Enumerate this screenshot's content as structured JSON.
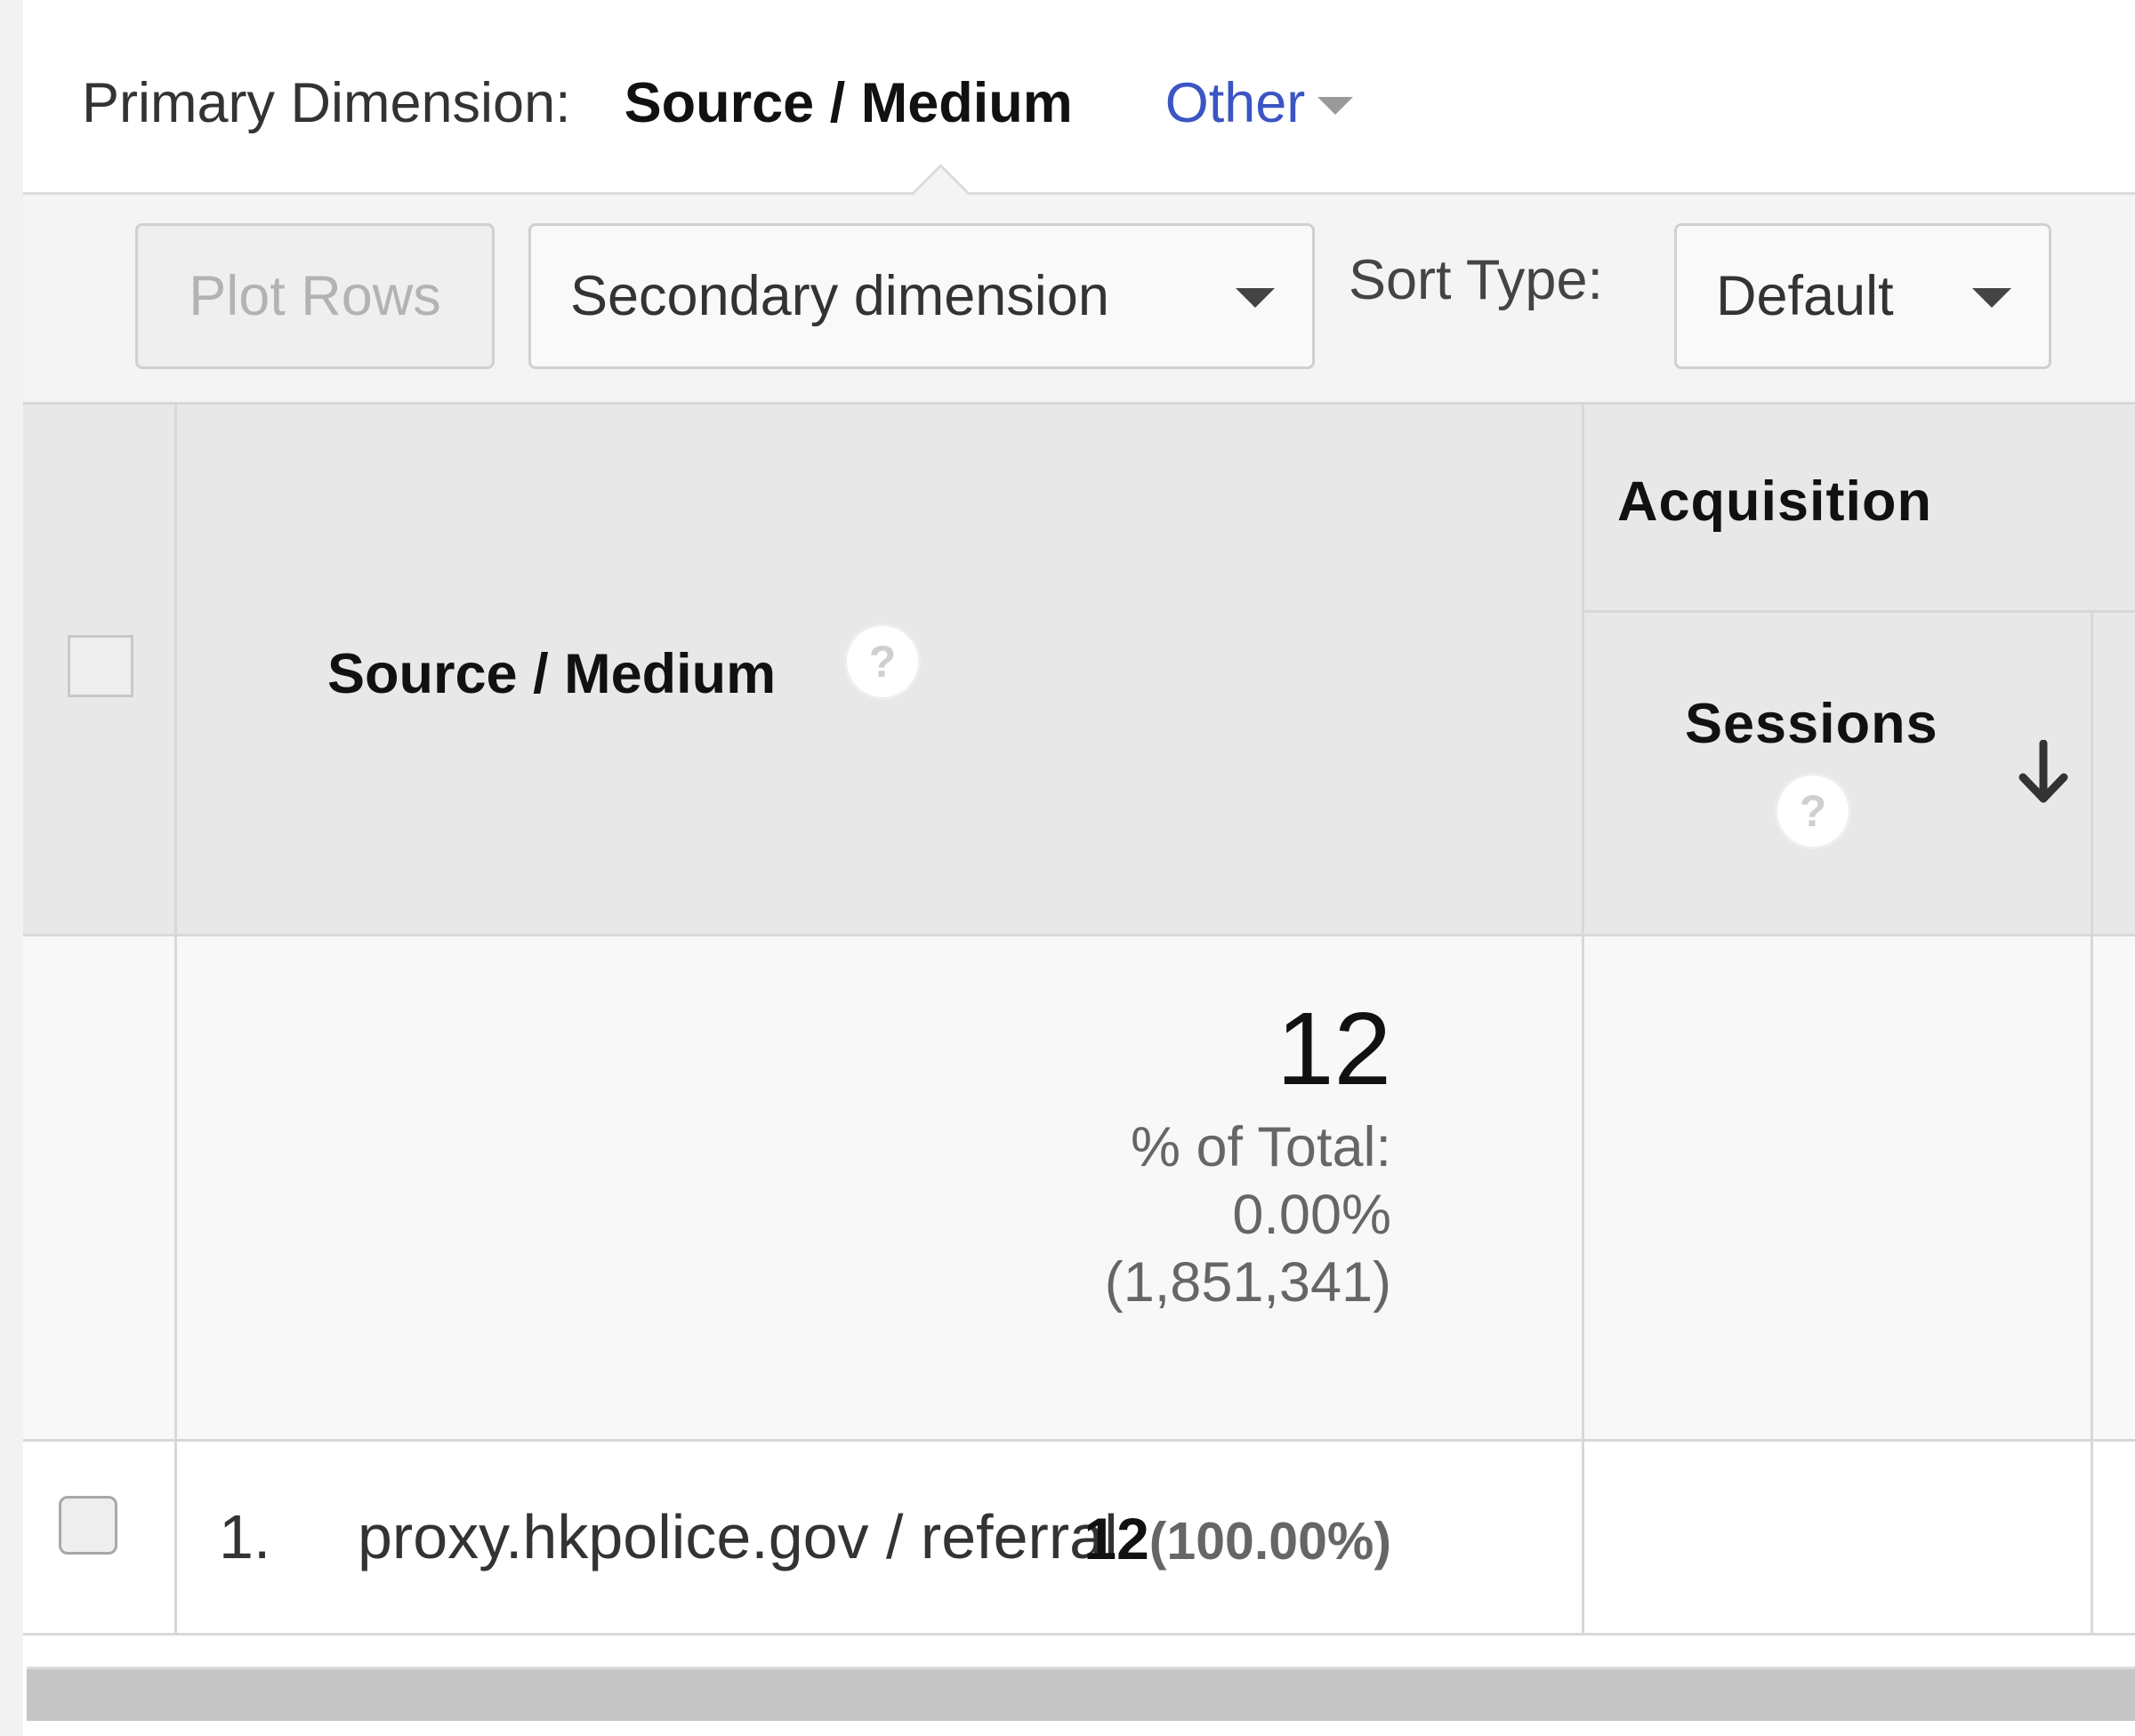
{
  "primary_dimension": {
    "label": "Primary Dimension:",
    "active": "Source / Medium",
    "other": "Other"
  },
  "toolbar": {
    "plot_rows": "Plot Rows",
    "secondary_dimension": "Secondary dimension",
    "sort_type_label": "Sort Type:",
    "sort_type_value": "Default"
  },
  "table": {
    "dimension_header": "Source / Medium",
    "group_header": "Acquisition",
    "metric_header": "Sessions",
    "help_glyph": "?",
    "totals": {
      "sessions": "12",
      "pct_label": "% of Total:",
      "pct_value": "0.00%",
      "total_value": "(1,851,341)"
    },
    "rows": [
      {
        "index": "1.",
        "source_medium": "proxy.hkpolice.gov / referral",
        "sessions": "12",
        "sessions_pct": "(100.00%)"
      }
    ]
  },
  "colors": {
    "link": "#3b55c4",
    "header_bg": "#e8e8e8"
  }
}
